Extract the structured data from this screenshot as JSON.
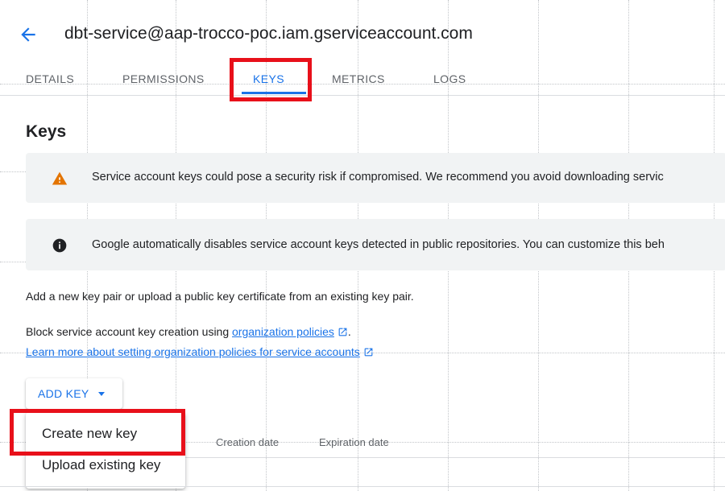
{
  "header": {
    "title": "dbt-service@aap-trocco-poc.iam.gserviceaccount.com"
  },
  "tabs": [
    {
      "label": "DETAILS",
      "active": false
    },
    {
      "label": "PERMISSIONS",
      "active": false
    },
    {
      "label": "KEYS",
      "active": true
    },
    {
      "label": "METRICS",
      "active": false
    },
    {
      "label": "LOGS",
      "active": false
    }
  ],
  "keys": {
    "title": "Keys",
    "warning_banner": "Service account keys could pose a security risk if compromised. We recommend you avoid downloading servic",
    "info_banner": "Google automatically disables service account keys detected in public repositories. You can customize this beh",
    "intro": "Add a new key pair or upload a public key certificate from an existing key pair.",
    "block_prefix": "Block service account key creation using ",
    "block_link": "organization policies",
    "block_suffix": ".",
    "learn_more_link": "Learn more about setting organization policies for service accounts",
    "add_key_label": "ADD KEY",
    "menu": [
      {
        "label": "Create new key"
      },
      {
        "label": "Upload existing key"
      }
    ],
    "table_headers": [
      "Creation date",
      "Expiration date"
    ]
  },
  "icons": {
    "back": "arrow-back-icon",
    "warning": "warning-icon",
    "info": "info-icon",
    "external": "open-in-new-icon",
    "dropdown": "caret-down-icon"
  },
  "colors": {
    "accent": "#1a73e8",
    "highlight": "#e8101a",
    "warning": "#e37400",
    "banner_bg": "#f1f3f4"
  }
}
